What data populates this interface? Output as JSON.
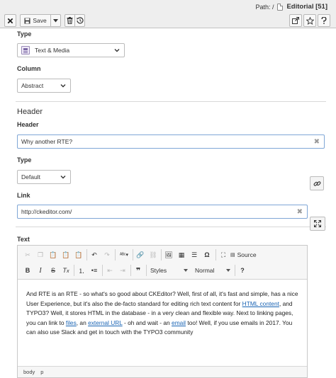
{
  "header": {
    "path_label": "Path: /",
    "record_title": "Editorial [51]",
    "save_label": "Save"
  },
  "form": {
    "type_label": "Type",
    "type_value": "Text & Media",
    "column_label": "Column",
    "column_value": "Abstract",
    "header_section_title": "Header",
    "header_label": "Header",
    "header_value": "Why another RTE?",
    "header_type_label": "Type",
    "header_type_value": "Default",
    "link_label": "Link",
    "link_value": "http://ckeditor.com/",
    "text_label": "Text"
  },
  "editor": {
    "source_label": "Source",
    "styles_label": "Styles",
    "format_label": "Normal",
    "paragraph": {
      "t1": "And RTE is an RTE - so what's so good about CKEditor? Well, first of all, it's fast and simple, has a nice User Experience, but it's also the de-facto standard for editing rich text content for ",
      "link1": "HTML content",
      "t2": ", and TYPO3? Well, it stores HTML in the database - in a very clean and flexible way. Next to linking pages, you can link to ",
      "link2": "files",
      "t3": ", an ",
      "link3": "external URL",
      "t4": " - oh and wait - an ",
      "link4": "email",
      "t5": " too! Well, if you use emails in 2017. You can also use Slack and get in touch with the TYPO3 community"
    },
    "status_path": [
      "body",
      "p"
    ]
  },
  "icons": {
    "close": "close-icon",
    "save": "save-icon",
    "delete": "trash-icon",
    "history": "history-icon",
    "open": "open-in-new-window-icon",
    "bookmark": "star-icon",
    "help": "help-icon",
    "link_wizard": "link-icon",
    "fullscreen": "fullscreen-icon"
  }
}
